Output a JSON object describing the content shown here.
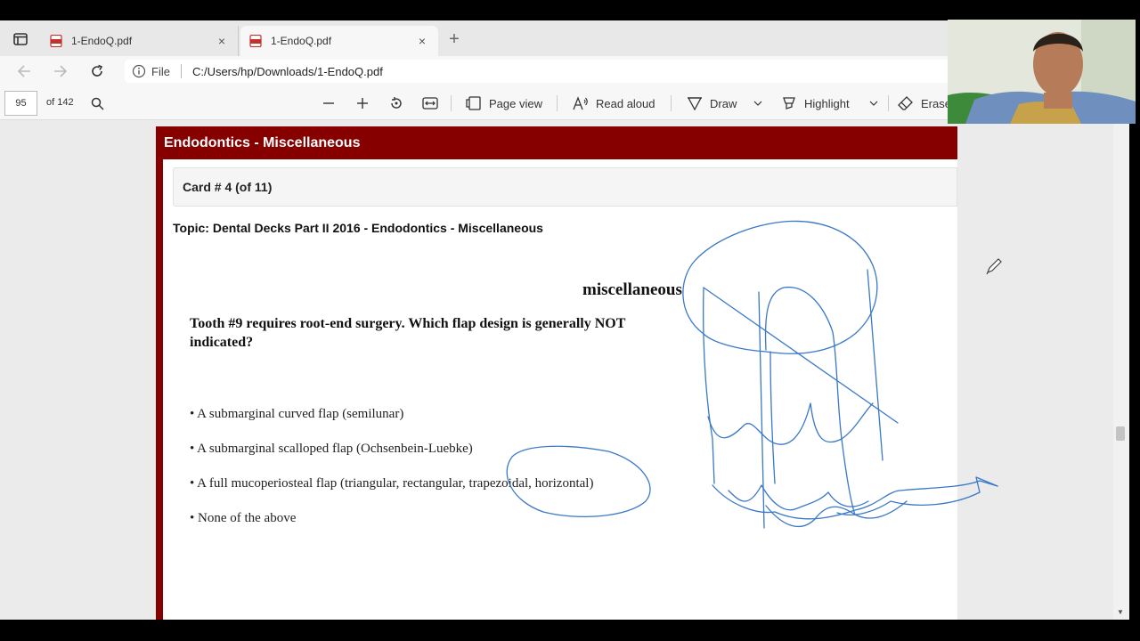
{
  "tabs": [
    {
      "title": "1-EndoQ.pdf",
      "close": "×"
    },
    {
      "title": "1-EndoQ.pdf",
      "close": "×"
    }
  ],
  "newtab": "+",
  "address": {
    "file_label": "File",
    "url": "C:/Users/hp/Downloads/1-EndoQ.pdf"
  },
  "pdf_toolbar": {
    "page_number": "95",
    "page_count": "of 142",
    "page_view": "Page view",
    "read_aloud": "Read aloud",
    "draw": "Draw",
    "highlight": "Highlight",
    "erase": "Erase"
  },
  "document": {
    "section_title": "Endodontics - Miscellaneous",
    "card_label": "Card # 4 (of 11)",
    "topic": "Topic: Dental Decks Part II 2016 - Endodontics - Miscellaneous",
    "heading": "miscellaneous",
    "question": "Tooth #9 requires root-end surgery. Which flap design is generally NOT indicated?",
    "options": [
      "• A submarginal curved flap (semilunar)",
      "• A submarginal scalloped flap (Ochsenbein-Luebke)",
      "• A full mucoperiosteal flap (triangular, rectangular, trapezoidal, horizontal)",
      "• None of  the above"
    ]
  },
  "colors": {
    "header_maroon": "#870000",
    "ink_blue": "#3a78c8"
  },
  "icons": [
    "tab-actions-icon",
    "pdf-icon",
    "back-icon",
    "forward-icon",
    "refresh-icon",
    "info-icon",
    "search-icon",
    "zoom-out-icon",
    "zoom-in-icon",
    "rotate-icon",
    "fit-width-icon",
    "page-view-icon",
    "read-aloud-icon",
    "draw-icon",
    "highlight-icon",
    "erase-icon",
    "pen-cursor-icon"
  ]
}
